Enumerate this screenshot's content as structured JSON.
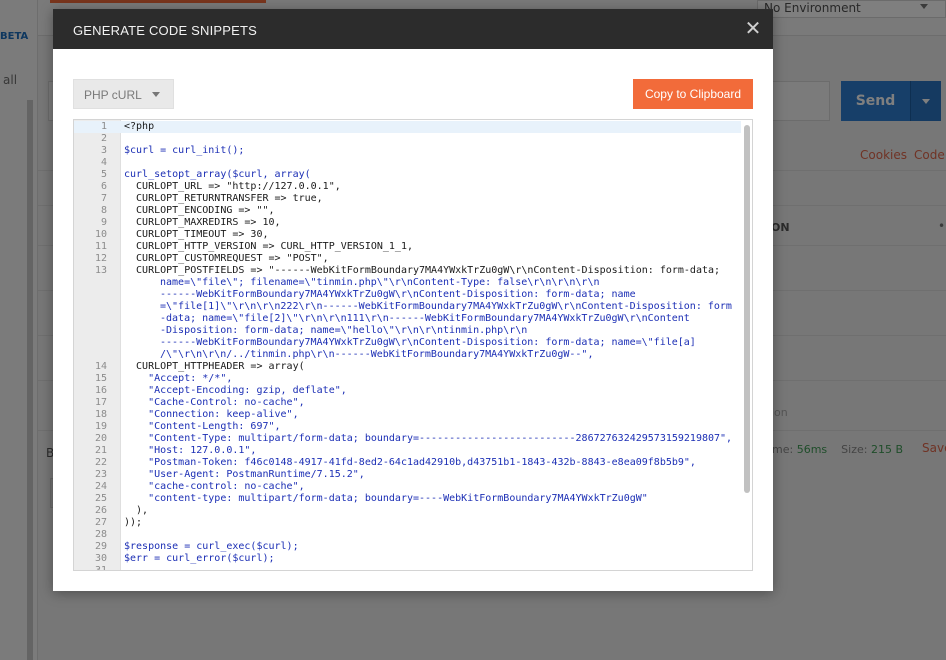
{
  "background": {
    "beta_label": "BETA",
    "all_label": "all",
    "environment": "No Environment",
    "send_label": "Send",
    "cookies_label": "Cookies",
    "code_label": "Code",
    "column_label": "ON",
    "faded_label": "ion",
    "time_label": "me:",
    "time_value": "56ms",
    "size_label": "Size:",
    "size_value": "215 B",
    "save_label": "Save",
    "tab_b_label": "B"
  },
  "modal": {
    "title": "GENERATE CODE SNIPPETS",
    "close_icon": "close-icon",
    "language": "PHP cURL",
    "copy_label": "Copy to Clipboard",
    "accent": "#f26b3a",
    "code_lines": [
      {
        "n": "1",
        "t": "<?php"
      },
      {
        "n": "2",
        "t": ""
      },
      {
        "n": "3",
        "t": "$curl = curl_init();"
      },
      {
        "n": "4",
        "t": ""
      },
      {
        "n": "5",
        "t": "curl_setopt_array($curl, array("
      },
      {
        "n": "6",
        "t": "  CURLOPT_URL => \"http://127.0.0.1\","
      },
      {
        "n": "7",
        "t": "  CURLOPT_RETURNTRANSFER => true,"
      },
      {
        "n": "8",
        "t": "  CURLOPT_ENCODING => \"\","
      },
      {
        "n": "9",
        "t": "  CURLOPT_MAXREDIRS => 10,"
      },
      {
        "n": "10",
        "t": "  CURLOPT_TIMEOUT => 30,"
      },
      {
        "n": "11",
        "t": "  CURLOPT_HTTP_VERSION => CURL_HTTP_VERSION_1_1,"
      },
      {
        "n": "12",
        "t": "  CURLOPT_CUSTOMREQUEST => \"POST\","
      },
      {
        "n": "13",
        "t": "  CURLOPT_POSTFIELDS => \"------WebKitFormBoundary7MA4YWxkTrZu0gW\\r\\nContent-Disposition: form-data;"
      },
      {
        "n": "",
        "t": "name=\\\"file\\\"; filename=\\\"tinmin.php\\\"\\r\\nContent-Type: false\\r\\n\\r\\n\\r\\n"
      },
      {
        "n": "",
        "t": "------WebKitFormBoundary7MA4YWxkTrZu0gW\\r\\nContent-Disposition: form-data; name"
      },
      {
        "n": "",
        "t": "=\\\"file[1]\\\"\\r\\n\\r\\n222\\r\\n------WebKitFormBoundary7MA4YWxkTrZu0gW\\r\\nContent-Disposition: form"
      },
      {
        "n": "",
        "t": "-data; name=\\\"file[2]\\\"\\r\\n\\r\\n111\\r\\n------WebKitFormBoundary7MA4YWxkTrZu0gW\\r\\nContent"
      },
      {
        "n": "",
        "t": "-Disposition: form-data; name=\\\"hello\\\"\\r\\n\\r\\ntinmin.php\\r\\n"
      },
      {
        "n": "",
        "t": "------WebKitFormBoundary7MA4YWxkTrZu0gW\\r\\nContent-Disposition: form-data; name=\\\"file[a]"
      },
      {
        "n": "",
        "t": "/\\\"\\r\\n\\r\\n/../tinmin.php\\r\\n------WebKitFormBoundary7MA4YWxkTrZu0gW--\","
      },
      {
        "n": "14",
        "t": "  CURLOPT_HTTPHEADER => array("
      },
      {
        "n": "15",
        "t": "    \"Accept: */*\","
      },
      {
        "n": "16",
        "t": "    \"Accept-Encoding: gzip, deflate\","
      },
      {
        "n": "17",
        "t": "    \"Cache-Control: no-cache\","
      },
      {
        "n": "18",
        "t": "    \"Connection: keep-alive\","
      },
      {
        "n": "19",
        "t": "    \"Content-Length: 697\","
      },
      {
        "n": "20",
        "t": "    \"Content-Type: multipart/form-data; boundary=--------------------------286727632429573159219807\","
      },
      {
        "n": "21",
        "t": "    \"Host: 127.0.0.1\","
      },
      {
        "n": "22",
        "t": "    \"Postman-Token: f46c0148-4917-41fd-8ed2-64c1ad42910b,d43751b1-1843-432b-8843-e8ea09f8b5b9\","
      },
      {
        "n": "23",
        "t": "    \"User-Agent: PostmanRuntime/7.15.2\","
      },
      {
        "n": "24",
        "t": "    \"cache-control: no-cache\","
      },
      {
        "n": "25",
        "t": "    \"content-type: multipart/form-data; boundary=----WebKitFormBoundary7MA4YWxkTrZu0gW\""
      },
      {
        "n": "26",
        "t": "  ),"
      },
      {
        "n": "27",
        "t": "));"
      },
      {
        "n": "28",
        "t": ""
      },
      {
        "n": "29",
        "t": "$response = curl_exec($curl);"
      },
      {
        "n": "30",
        "t": "$err = curl_error($curl);"
      },
      {
        "n": "31",
        "t": ""
      }
    ]
  }
}
